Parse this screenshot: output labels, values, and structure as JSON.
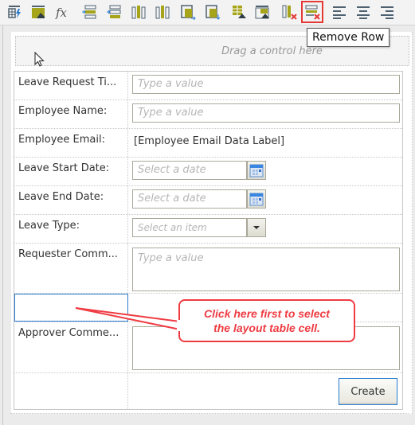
{
  "toolbar": {
    "buttons": [
      {
        "id": "data-binding",
        "icon": "table-lightning-icon"
      },
      {
        "id": "insert-image",
        "icon": "image-icon"
      },
      {
        "id": "formula",
        "icon": "fx-icon"
      },
      {
        "id": "insert-row-above",
        "icon": "insert-row-above-icon"
      },
      {
        "id": "insert-row-below",
        "icon": "insert-row-below-icon"
      },
      {
        "id": "insert-column-left",
        "icon": "insert-column-left-icon"
      },
      {
        "id": "insert-column-right",
        "icon": "insert-column-right-icon"
      },
      {
        "id": "merge-right",
        "icon": "merge-right-icon"
      },
      {
        "id": "merge-down",
        "icon": "merge-down-icon"
      },
      {
        "id": "split-cells",
        "icon": "split-cells-icon"
      },
      {
        "id": "cell-properties",
        "icon": "cell-properties-icon"
      },
      {
        "id": "remove-column",
        "icon": "remove-column-icon"
      },
      {
        "id": "remove-row",
        "icon": "remove-row-icon",
        "highlighted": true
      },
      {
        "id": "align-left",
        "icon": "align-left-icon"
      },
      {
        "id": "align-center",
        "icon": "align-center-icon"
      },
      {
        "id": "align-right",
        "icon": "align-right-icon"
      }
    ],
    "tooltip": "Remove Row"
  },
  "form": {
    "drop_zone_text": "Drag a control here",
    "rows": [
      {
        "label": "Leave Request Ti...",
        "type": "text",
        "placeholder": "Type a value"
      },
      {
        "label": "Employee Name:",
        "type": "text",
        "placeholder": "Type a value"
      },
      {
        "label": "Employee Email:",
        "type": "label",
        "value": "[Employee Email Data Label]"
      },
      {
        "label": "Leave Start Date:",
        "type": "date",
        "placeholder": "Select a date"
      },
      {
        "label": "Leave End Date:",
        "type": "date",
        "placeholder": "Select a date"
      },
      {
        "label": "Leave Type:",
        "type": "select",
        "placeholder": "Select an item"
      },
      {
        "label": "Requester Comm...",
        "type": "textarea",
        "placeholder": "Type a value"
      },
      {
        "label": "",
        "type": "empty",
        "selected": true
      },
      {
        "label": "Approver Comme...",
        "type": "textarea",
        "placeholder": ""
      },
      {
        "label": "",
        "type": "button",
        "button_label": "Create"
      }
    ]
  },
  "callout": {
    "line1": "Click here first to select",
    "line2": "the layout table cell.",
    "color": "#ef3b42"
  },
  "colors": {
    "accent_blue": "#2b7bd1",
    "highlight_red": "#e53935",
    "toolbar_olive": "#a6a41a",
    "toolbar_slate": "#4e6170"
  }
}
